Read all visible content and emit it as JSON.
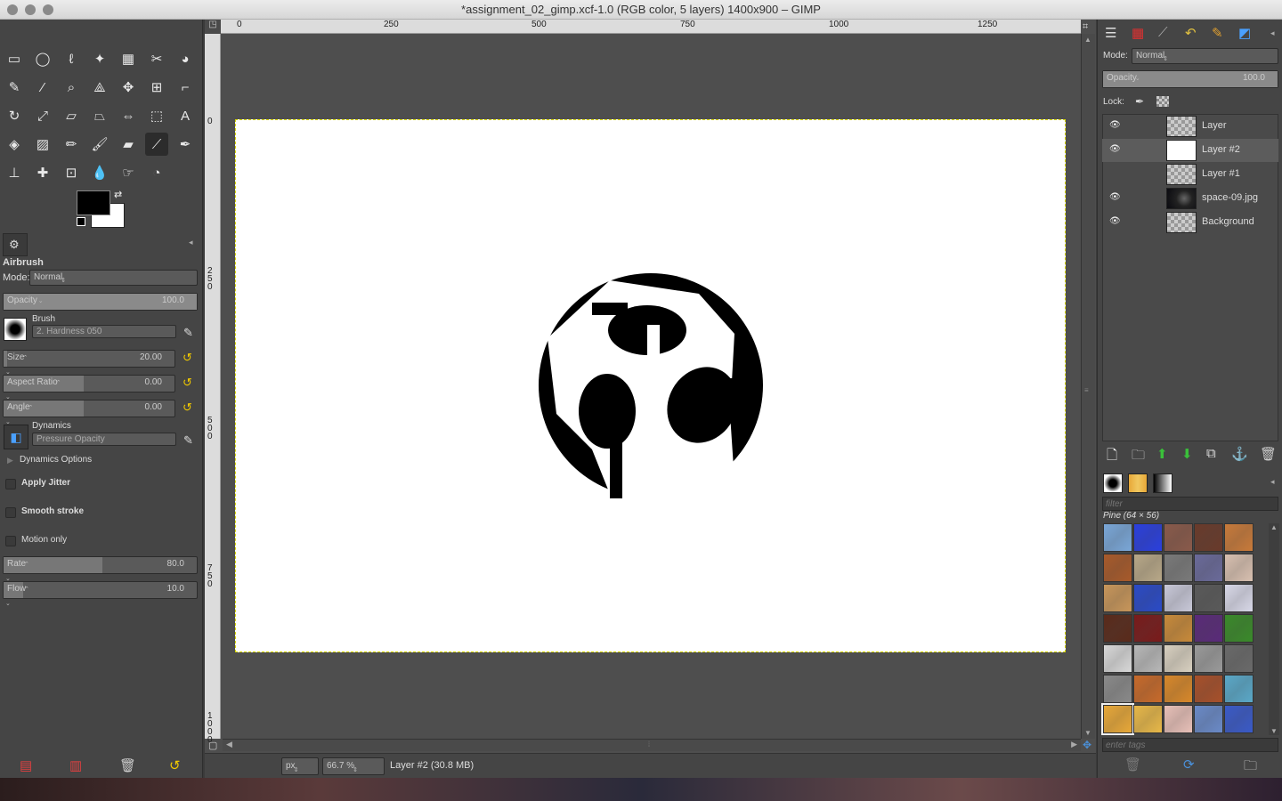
{
  "window": {
    "title": "*assignment_02_gimp.xcf-1.0 (RGB color, 5 layers) 1400x900 – GIMP"
  },
  "toolbox": {
    "tools": [
      {
        "name": "rect-select-icon",
        "glyph": "▭"
      },
      {
        "name": "ellipse-select-icon",
        "glyph": "◯"
      },
      {
        "name": "free-select-icon",
        "glyph": "ℓ"
      },
      {
        "name": "fuzzy-select-icon",
        "glyph": "✦"
      },
      {
        "name": "select-by-color-icon",
        "glyph": "▦"
      },
      {
        "name": "scissors-icon",
        "glyph": "✂"
      },
      {
        "name": "foreground-select-icon",
        "glyph": "◕"
      },
      {
        "name": "paths-icon",
        "glyph": "✎"
      },
      {
        "name": "color-picker-icon",
        "glyph": "⁄"
      },
      {
        "name": "zoom-icon",
        "glyph": "⌕"
      },
      {
        "name": "measure-icon",
        "glyph": "⟁"
      },
      {
        "name": "move-icon",
        "glyph": "✥"
      },
      {
        "name": "align-icon",
        "glyph": "⊞"
      },
      {
        "name": "crop-icon",
        "glyph": "⌐"
      },
      {
        "name": "rotate-icon",
        "glyph": "↻"
      },
      {
        "name": "scale-icon",
        "glyph": "⤢"
      },
      {
        "name": "shear-icon",
        "glyph": "▱"
      },
      {
        "name": "perspective-icon",
        "glyph": "⏢"
      },
      {
        "name": "flip-icon",
        "glyph": "⇔"
      },
      {
        "name": "cage-icon",
        "glyph": "⬚"
      },
      {
        "name": "text-icon",
        "glyph": "A"
      },
      {
        "name": "bucket-fill-icon",
        "glyph": "◈"
      },
      {
        "name": "blend-icon",
        "glyph": "▨"
      },
      {
        "name": "pencil-icon",
        "glyph": "✏"
      },
      {
        "name": "paintbrush-icon",
        "glyph": "🖌"
      },
      {
        "name": "eraser-icon",
        "glyph": "▰"
      },
      {
        "name": "airbrush-icon",
        "glyph": "⟋"
      },
      {
        "name": "ink-icon",
        "glyph": "✒"
      },
      {
        "name": "clone-icon",
        "glyph": "⊥"
      },
      {
        "name": "heal-icon",
        "glyph": "✚"
      },
      {
        "name": "perspective-clone-icon",
        "glyph": "⊡"
      },
      {
        "name": "blur-icon",
        "glyph": "💧"
      },
      {
        "name": "smudge-icon",
        "glyph": "☞"
      },
      {
        "name": "dodge-burn-icon",
        "glyph": "◔"
      }
    ],
    "tool_options": {
      "title": "Airbrush",
      "mode_label": "Mode:",
      "mode_value": "Normal",
      "opacity_label": "Opacity",
      "opacity_value": "100.0",
      "brush_label": "Brush",
      "brush_value": "2. Hardness 050",
      "size_label": "Size",
      "size_value": "20.00",
      "aspect_label": "Aspect Ratio",
      "aspect_value": "0.00",
      "angle_label": "Angle",
      "angle_value": "0.00",
      "dynamics_label": "Dynamics",
      "dynamics_value": "Pressure Opacity",
      "dynamics_options": "Dynamics Options",
      "apply_jitter": "Apply Jitter",
      "smooth_stroke": "Smooth stroke",
      "motion_only": "Motion only",
      "rate_label": "Rate",
      "rate_value": "80.0",
      "flow_label": "Flow",
      "flow_value": "10.0"
    }
  },
  "canvas": {
    "ruler_h": [
      "0",
      "250",
      "500",
      "750",
      "1000",
      "1250"
    ],
    "ruler_v": [
      "0",
      "250",
      "500",
      "750",
      "1000"
    ],
    "status": {
      "unit": "px",
      "zoom": "66.7 %",
      "layer_info": "Layer #2 (30.8 MB)"
    }
  },
  "layers_panel": {
    "mode_label": "Mode:",
    "mode_value": "Normal",
    "opacity_label": "Opacity",
    "opacity_value": "100.0",
    "lock_label": "Lock:",
    "layers": [
      {
        "name": "Layer",
        "visible": true
      },
      {
        "name": "Layer #2",
        "visible": true
      },
      {
        "name": "Layer #1",
        "visible": false
      },
      {
        "name": "space-09.jpg",
        "visible": true
      },
      {
        "name": "Background",
        "visible": true
      }
    ]
  },
  "patterns_panel": {
    "filter_placeholder": "filter",
    "selected_pattern": "Pine (64 × 56)",
    "tags_placeholder": "enter tags",
    "pattern_colors": [
      "#7aa7d8",
      "#2a3fdf",
      "#8a5a4a",
      "#6a3a2a",
      "#c87a3a",
      "#a85a2a",
      "#b8a888",
      "#7a7a7a",
      "#6a6a9a",
      "#d8c0b0",
      "#c8965a",
      "#2a4ac8",
      "#c8c8d8",
      "#5a5a5a",
      "#d8d8e8",
      "#5a2a1a",
      "#7a1a1a",
      "#c88a3a",
      "#5a2a7a",
      "#3a8a2a",
      "#d8d8d8",
      "#b8b8b8",
      "#d8d0c0",
      "#9a9a9a",
      "#6a6a6a",
      "#8a8a8a",
      "#c86a2a",
      "#d8882a",
      "#a8502a",
      "#5aa8c8",
      "#e8a838",
      "#e8b848",
      "#e8c0b8",
      "#6a8ac8",
      "#3a5ac8"
    ]
  },
  "colors": {
    "foreground": "#000000",
    "background": "#ffffff",
    "accent": "#f0c800"
  }
}
